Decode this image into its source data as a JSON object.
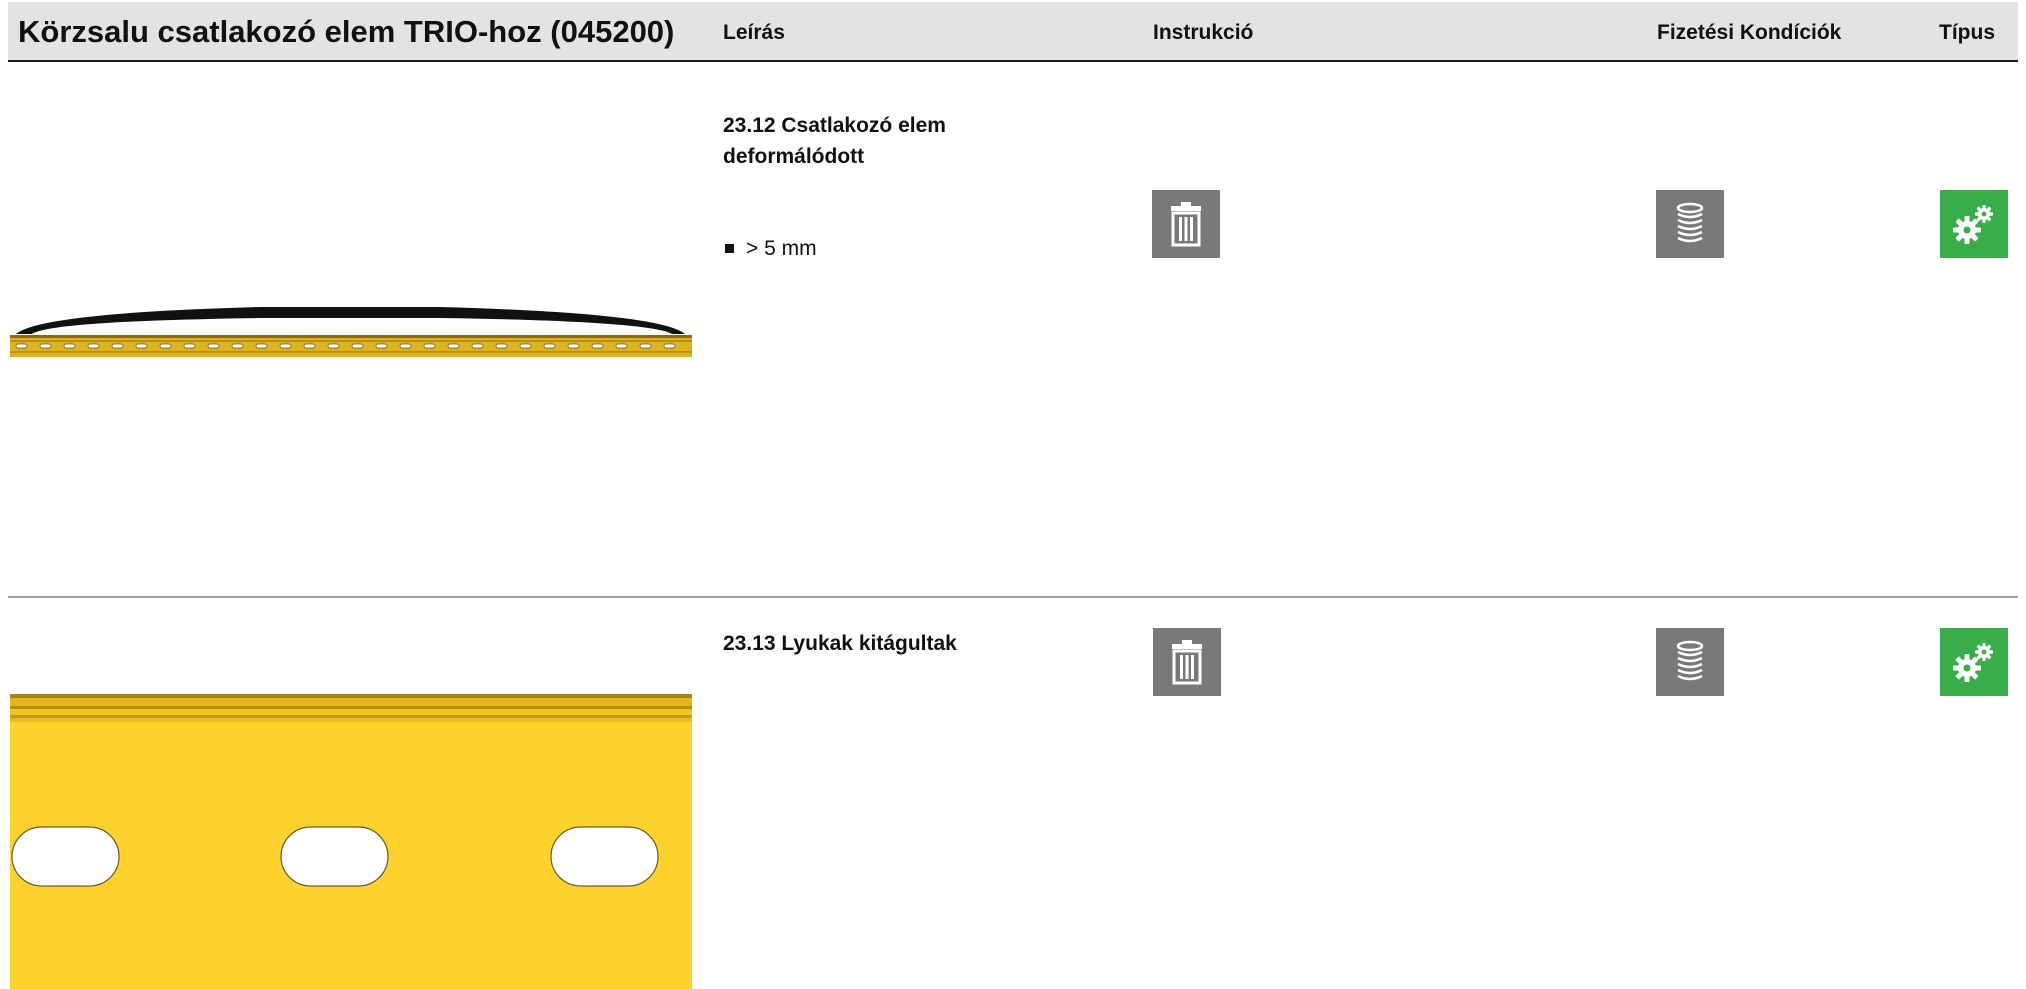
{
  "header": {
    "title": "Körzsalu csatlakozó elem TRIO-hoz (045200)",
    "col_description": "Leírás",
    "col_instruction": "Instrukció",
    "col_payment": "Fizetési Kondíciók",
    "col_type": "Típus"
  },
  "rows": [
    {
      "title": "23.12 Csatlakozó elem deformálódott",
      "bullet": "> 5 mm",
      "instruction_icon": "trash-icon",
      "payment_icon": "coin-stack-icon",
      "type_icon": "gears-icon"
    },
    {
      "title": "23.13 Lyukak kitágultak",
      "instruction_icon": "trash-icon",
      "payment_icon": "coin-stack-icon",
      "type_icon": "gears-icon"
    }
  ],
  "colors": {
    "header_bg": "#e3e3e3",
    "icon_gray": "#797979",
    "icon_green": "#3aad4b",
    "part_yellow": "#ffd22e"
  }
}
